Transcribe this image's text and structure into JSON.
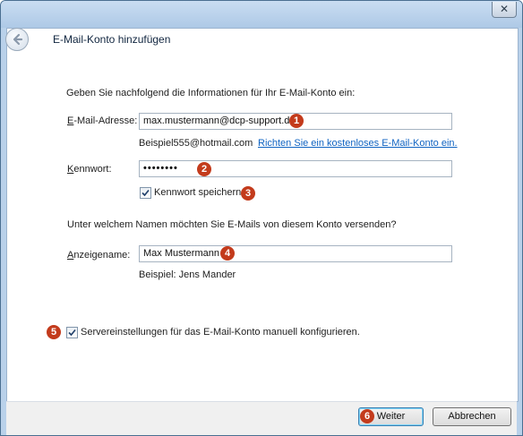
{
  "window": {
    "title": "E-Mail-Konto hinzufügen",
    "close_glyph": "✕"
  },
  "form": {
    "intro": "Geben Sie nachfolgend die Informationen für Ihr E-Mail-Konto ein:",
    "email_label": "E-Mail-Adresse:",
    "email_value": "max.mustermann@dcp-support.de",
    "email_hint": "Beispiel555@hotmail.com",
    "email_link": "Richten Sie ein kostenloses E-Mail-Konto ein.",
    "password_label": "Kennwort:",
    "password_value": "••••••••",
    "save_password_label": "Kennwort speichern",
    "sender_question": "Unter welchem Namen möchten Sie E-Mails von diesem Konto versenden?",
    "display_name_label": "Anzeigename:",
    "display_name_value": "Max Mustermann",
    "display_name_hint": "Beispiel: Jens Mander",
    "manual_config_label": "Servereinstellungen für das E-Mail-Konto manuell konfigurieren."
  },
  "badges": [
    "1",
    "2",
    "3",
    "4",
    "5",
    "6"
  ],
  "footer": {
    "next_label": "Weiter",
    "cancel_label": "Abbrechen"
  },
  "icons": {
    "back": "back-arrow-icon",
    "checkmark": "checkmark-icon"
  },
  "colors": {
    "badge": "#c33b1c",
    "link": "#0f63c2",
    "frame": "#b9d1ea"
  }
}
